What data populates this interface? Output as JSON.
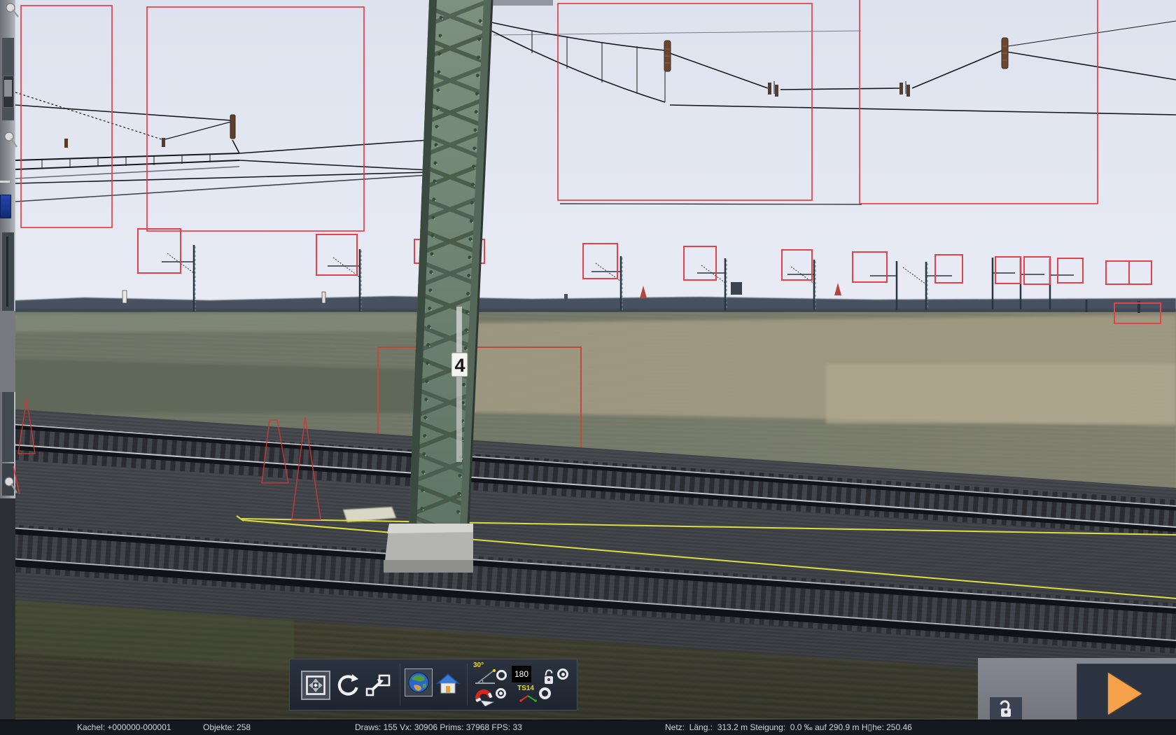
{
  "viewport": {
    "mast_sign": "4",
    "scene": "railway 3d editor view with catenary masts, selected objects outlined in red and a yellow highlighted track spline"
  },
  "toolbar": {
    "slope_value": "30°",
    "rotation_value": "180",
    "ts_value": "TS14",
    "icons": [
      "move-icon",
      "rotate-icon",
      "scale-icon",
      "globe-icon",
      "home-icon",
      "slope-angle-icon",
      "radio-icon",
      "lock-open-icon",
      "radio-selected-icon",
      "magnet-icon",
      "ts-direction-icon"
    ]
  },
  "playback": {
    "icons": [
      "lock-open-icon",
      "play-icon"
    ]
  },
  "left_dock": {
    "icons": [
      "pin-icon",
      "pin-icon",
      "pin-icon"
    ]
  },
  "status_bar": {
    "tile": "Kachel: +000000-000001",
    "objects": "Objekte: 258",
    "performance": "Draws: 155 Vx: 30906 Prims: 37968 FPS: 33",
    "network": "Netz:  Läng.:  313.2 m Steigung:  0.0 ‰ auf 290.9 m H▯he: 250.46"
  },
  "colors": {
    "selection_red": "#e8353d",
    "mid_selection_red": "#c2483b",
    "spline_yellow": "#e6e641",
    "play_orange": "#f5a04a",
    "mast_green": "#6f8471",
    "toolbar_bg": "#222a36",
    "status_bg": "#14181f"
  }
}
